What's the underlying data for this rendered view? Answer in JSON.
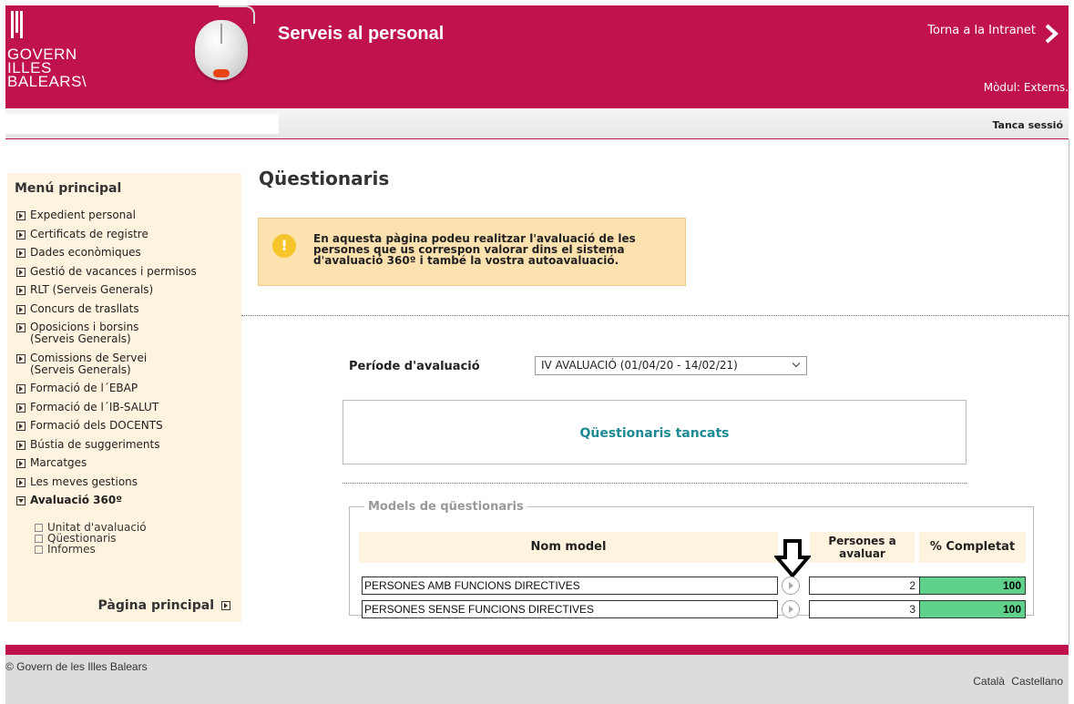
{
  "header": {
    "logo_lines": [
      "GOVERN",
      "ILLES",
      "BALEARS\\"
    ],
    "title": "Serveis al personal",
    "intranet_link": "Torna a la Intranet",
    "module": "Mòdul: Externs."
  },
  "subbar": {
    "logout": "Tanca sessió"
  },
  "sidebar": {
    "title": "Menú principal",
    "items": [
      "Expedient personal",
      "Certificats de registre",
      "Dades econòmiques",
      "Gestió de vacances i permisos",
      "RLT (Serveis Generals)",
      "Concurs de trasllats",
      "Oposicions i borsins (Serveis Generals)",
      "Comissions de Servei (Serveis Generals)",
      "Formació de l´EBAP",
      "Formació de l´IB-SALUT",
      "Formació dels DOCENTS",
      "Bústia de suggeriments",
      "Marcatges",
      "Les meves gestions"
    ],
    "expanded": {
      "label": "Avaluació 360º",
      "children": [
        "Unitat d'avaluació",
        "Qüestionaris",
        "Informes"
      ]
    },
    "home_link": "Pàgina principal"
  },
  "main": {
    "title": "Qüestionaris",
    "notice": "En aquesta pàgina podeu realitzar l'avaluació de les persones que us correspon valorar dins el sistema d'avaluació 360º i també la vostra autoavaluació.",
    "period_label": "Període d'avaluació",
    "period_value": "IV AVALUACIÓ (01/04/20 - 14/02/21)",
    "closed_label": "Qüestionaris tancats",
    "models": {
      "legend": "Models de qüestionaris",
      "headers": {
        "name": "Nom model",
        "persons": "Persones a avaluar",
        "completed": "% Completat"
      },
      "rows": [
        {
          "name": "PERSONES AMB FUNCIONS DIRECTIVES",
          "persons": "2",
          "completed": "100"
        },
        {
          "name": "PERSONES SENSE FUNCIONS DIRECTIVES",
          "persons": "3",
          "completed": "100"
        }
      ]
    }
  },
  "footer": {
    "copyright": "© Govern de les Illes Balears",
    "lang_ca": "Català",
    "lang_es": "Castellano"
  },
  "colors": {
    "brand": "#c0124f",
    "sidebar_bg": "#fdf3de",
    "notice_bg": "#fde2b0",
    "accent_text": "#1d8a94",
    "completed_bg": "#5fd18b"
  }
}
